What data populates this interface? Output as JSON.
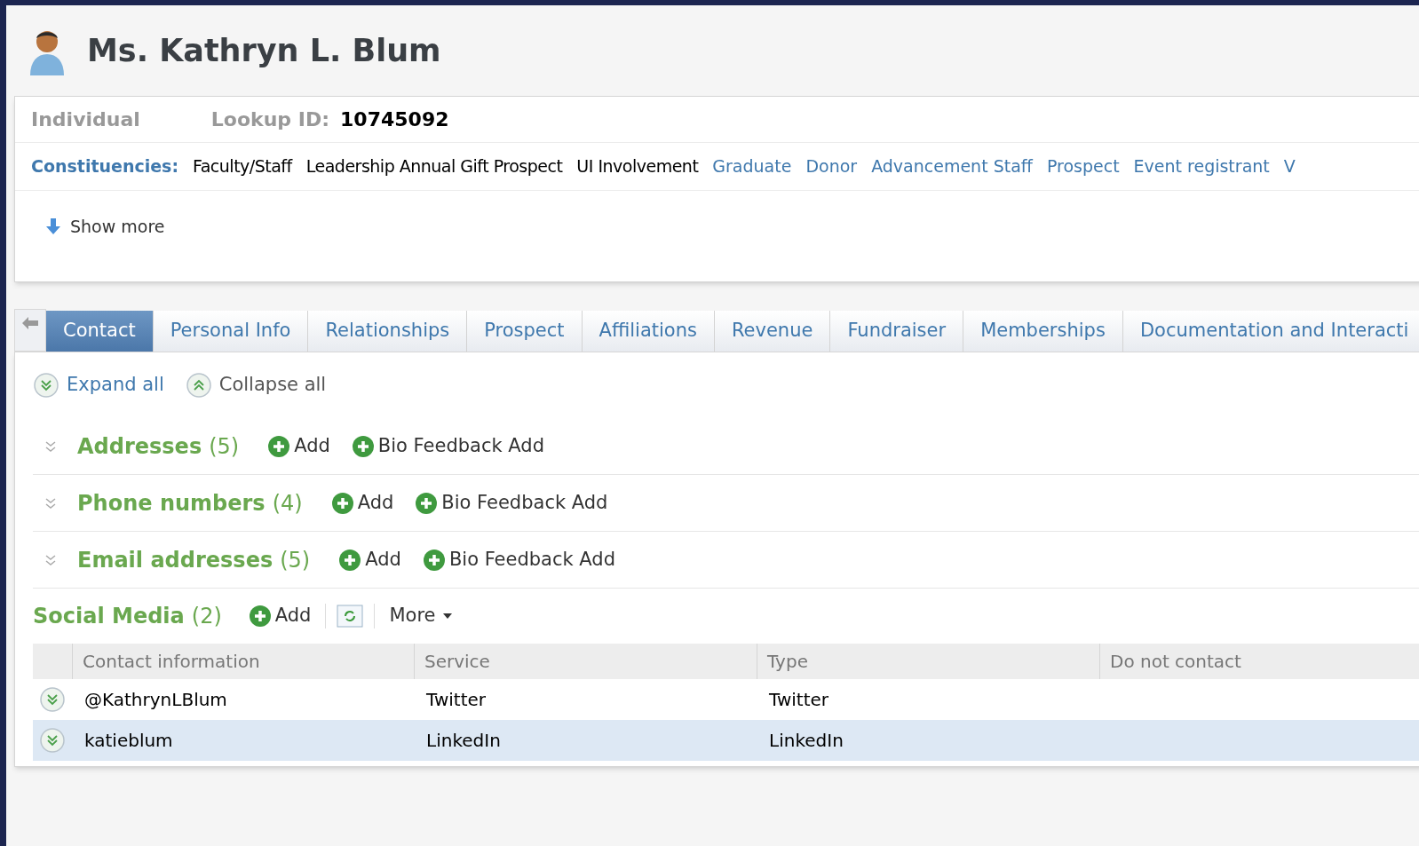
{
  "header": {
    "title": "Ms. Kathryn L. Blum"
  },
  "summary": {
    "type": "Individual",
    "lookup_label": "Lookup ID:",
    "lookup_value": "10745092",
    "constituencies_label": "Constituencies:",
    "constituencies": [
      {
        "label": "Faculty/Staff",
        "kind": "plain"
      },
      {
        "label": "Leadership Annual Gift Prospect",
        "kind": "plain"
      },
      {
        "label": "UI Involvement",
        "kind": "plain"
      },
      {
        "label": "Graduate",
        "kind": "link"
      },
      {
        "label": "Donor",
        "kind": "link"
      },
      {
        "label": "Advancement Staff",
        "kind": "link"
      },
      {
        "label": "Prospect",
        "kind": "link"
      },
      {
        "label": "Event registrant",
        "kind": "link"
      },
      {
        "label": "V",
        "kind": "link"
      }
    ],
    "show_more": "Show more"
  },
  "tabs": [
    {
      "label": "Contact",
      "selected": true
    },
    {
      "label": "Personal Info",
      "selected": false
    },
    {
      "label": "Relationships",
      "selected": false
    },
    {
      "label": "Prospect",
      "selected": false
    },
    {
      "label": "Affiliations",
      "selected": false
    },
    {
      "label": "Revenue",
      "selected": false
    },
    {
      "label": "Fundraiser",
      "selected": false
    },
    {
      "label": "Memberships",
      "selected": false
    },
    {
      "label": "Documentation and Interacti",
      "selected": false
    }
  ],
  "actions": {
    "expand_all": "Expand all",
    "collapse_all": "Collapse all"
  },
  "sections": [
    {
      "title": "Addresses",
      "count": "(5)",
      "buttons": [
        "Add",
        "Bio Feedback Add"
      ]
    },
    {
      "title": "Phone numbers",
      "count": "(4)",
      "buttons": [
        "Add",
        "Bio Feedback Add"
      ]
    },
    {
      "title": "Email addresses",
      "count": "(5)",
      "buttons": [
        "Add",
        "Bio Feedback Add"
      ]
    }
  ],
  "social_media": {
    "title": "Social Media",
    "count": "(2)",
    "add": "Add",
    "more": "More",
    "columns": [
      "Contact information",
      "Service",
      "Type",
      "Do not contact"
    ],
    "rows": [
      {
        "cells": [
          "@KathrynLBlum",
          "Twitter",
          "Twitter"
        ],
        "selected": false
      },
      {
        "cells": [
          "katieblum",
          "LinkedIn",
          "LinkedIn"
        ],
        "selected": true
      }
    ]
  }
}
